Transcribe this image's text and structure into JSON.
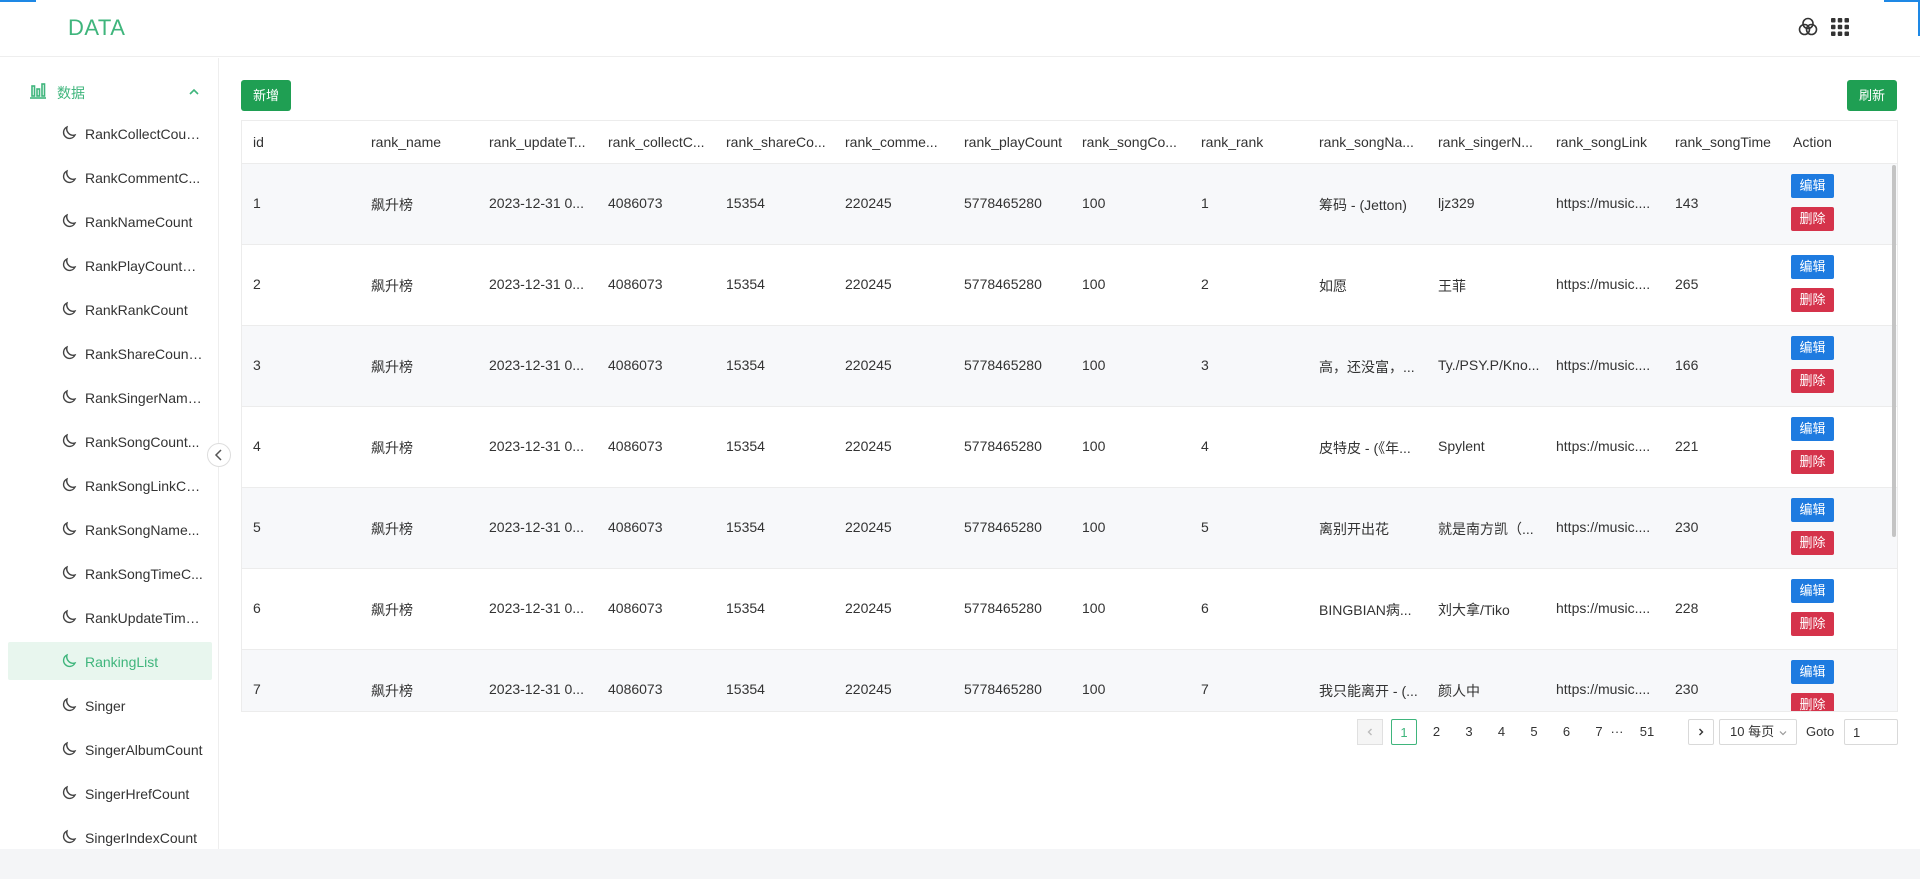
{
  "app": {
    "logo": "DATA"
  },
  "topbar": {
    "icons": [
      "theme-circles-icon",
      "apps-grid-icon"
    ]
  },
  "sidebar": {
    "group": {
      "label": "数据",
      "icon": "bar-chart-icon",
      "expanded": true
    },
    "items": [
      {
        "label": "RankCollectCoun..."
      },
      {
        "label": "RankCommentC..."
      },
      {
        "label": "RankNameCount"
      },
      {
        "label": "RankPlayCountC..."
      },
      {
        "label": "RankRankCount"
      },
      {
        "label": "RankShareCount..."
      },
      {
        "label": "RankSingerName..."
      },
      {
        "label": "RankSongCount..."
      },
      {
        "label": "RankSongLinkCo..."
      },
      {
        "label": "RankSongName..."
      },
      {
        "label": "RankSongTimeC..."
      },
      {
        "label": "RankUpdateTime..."
      },
      {
        "label": "RankingList",
        "active": true
      },
      {
        "label": "Singer"
      },
      {
        "label": "SingerAlbumCount"
      },
      {
        "label": "SingerHrefCount"
      },
      {
        "label": "SingerIndexCount"
      }
    ]
  },
  "toolbar": {
    "add_label": "新增",
    "refresh_label": "刷新"
  },
  "table": {
    "columns": [
      "id",
      "rank_name",
      "rank_updateT...",
      "rank_collectC...",
      "rank_shareCo...",
      "rank_comme...",
      "rank_playCount",
      "rank_songCo...",
      "rank_rank",
      "rank_songNa...",
      "rank_singerN...",
      "rank_songLink",
      "rank_songTime",
      "Action"
    ],
    "edit_label": "编辑",
    "delete_label": "删除",
    "rows": [
      [
        "1",
        "飙升榜",
        "2023-12-31 0...",
        "4086073",
        "15354",
        "220245",
        "5778465280",
        "100",
        "1",
        "筹码 - (Jetton)",
        "ljz329",
        "https://music....",
        "143"
      ],
      [
        "2",
        "飙升榜",
        "2023-12-31 0...",
        "4086073",
        "15354",
        "220245",
        "5778465280",
        "100",
        "2",
        "如愿",
        "王菲",
        "https://music....",
        "265"
      ],
      [
        "3",
        "飙升榜",
        "2023-12-31 0...",
        "4086073",
        "15354",
        "220245",
        "5778465280",
        "100",
        "3",
        "高，还没富，...",
        "Ty./PSY.P/Kno...",
        "https://music....",
        "166"
      ],
      [
        "4",
        "飙升榜",
        "2023-12-31 0...",
        "4086073",
        "15354",
        "220245",
        "5778465280",
        "100",
        "4",
        "皮特皮 - (《年...",
        "Spylent",
        "https://music....",
        "221"
      ],
      [
        "5",
        "飙升榜",
        "2023-12-31 0...",
        "4086073",
        "15354",
        "220245",
        "5778465280",
        "100",
        "5",
        "离别开出花",
        "就是南方凯（...",
        "https://music....",
        "230"
      ],
      [
        "6",
        "飙升榜",
        "2023-12-31 0...",
        "4086073",
        "15354",
        "220245",
        "5778465280",
        "100",
        "6",
        "BINGBIAN病...",
        "刘大拿/Tiko",
        "https://music....",
        "228"
      ],
      [
        "7",
        "飙升榜",
        "2023-12-31 0...",
        "4086073",
        "15354",
        "220245",
        "5778465280",
        "100",
        "7",
        "我只能离开 - (...",
        "颜人中",
        "https://music....",
        "230"
      ]
    ]
  },
  "pagination": {
    "pages": [
      "1",
      "2",
      "3",
      "4",
      "5",
      "6",
      "7"
    ],
    "ellipsis": "···",
    "last_page": "51",
    "current": "1",
    "page_size": "10 每页",
    "goto_label": "Goto",
    "goto_value": "1"
  },
  "colors": {
    "brand_green": "#3fb57c",
    "button_green": "#1f9f53",
    "edit_blue": "#1e7be0",
    "delete_red": "#d5334b"
  }
}
